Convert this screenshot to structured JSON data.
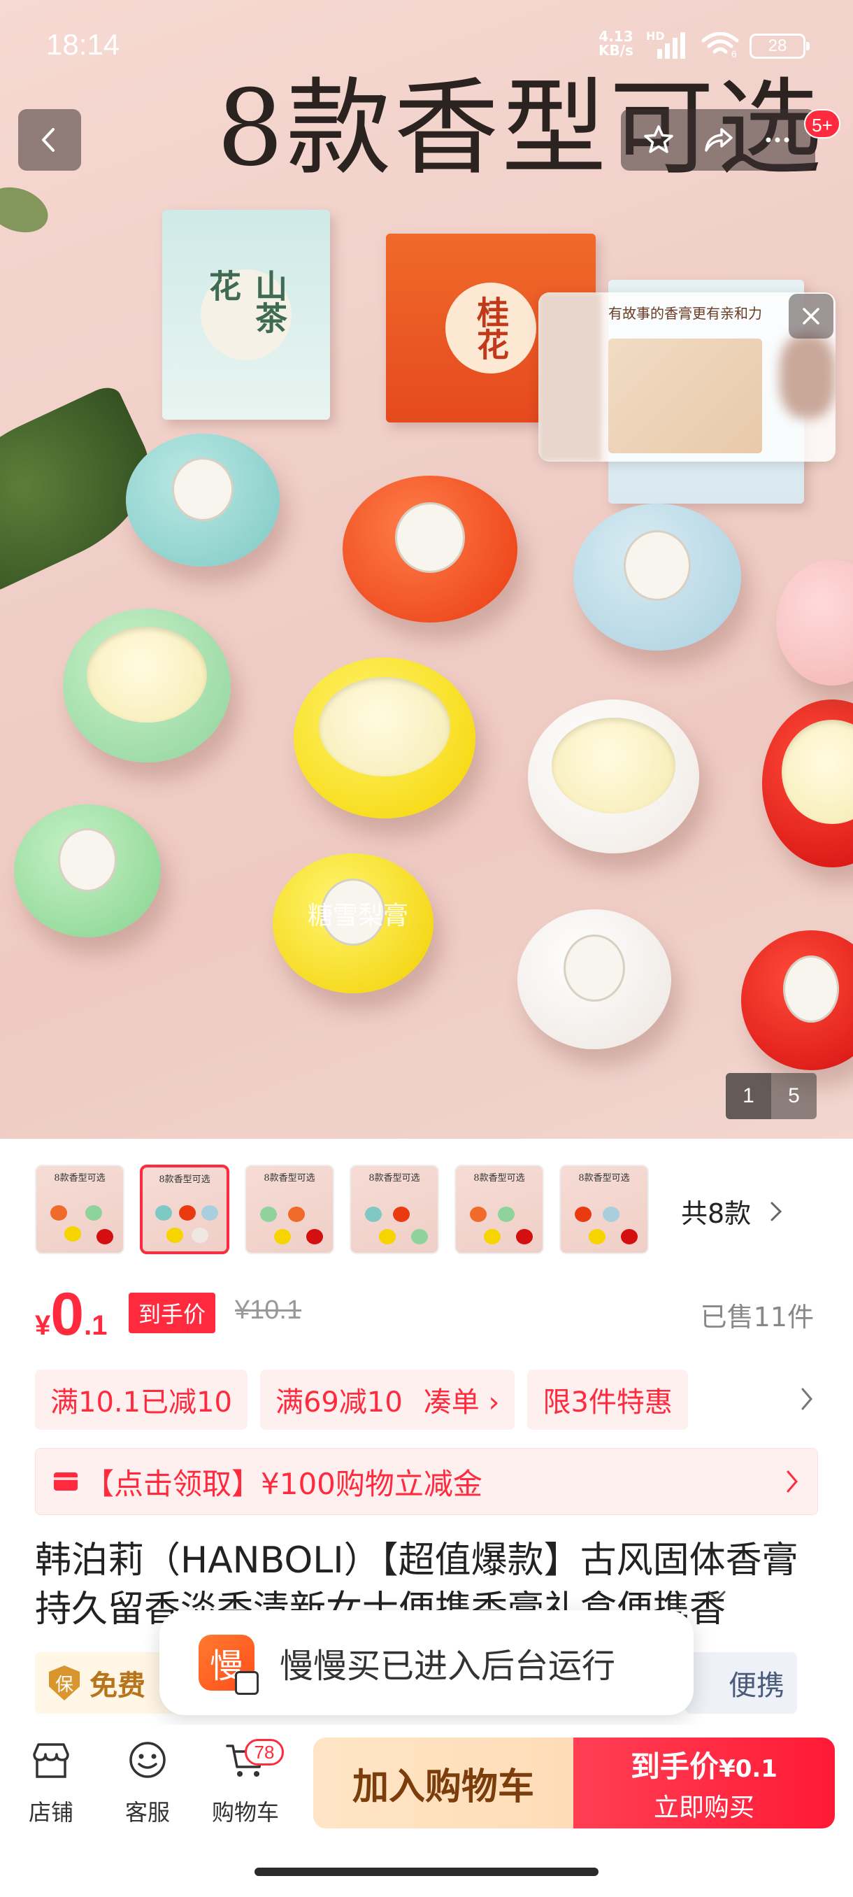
{
  "status_bar": {
    "time": "18:14",
    "net_speed": "4.13",
    "net_unit": "KB/s",
    "hd": "HD",
    "battery": "28",
    "wifi_badge": "6"
  },
  "hero": {
    "title": "8款香型可选",
    "watermark": "糖雪梨膏",
    "notification_count": "5+",
    "video_card_text": "有故事的香膏更有亲和力",
    "page_current": "1",
    "page_total": "5",
    "box_labels": [
      "山茶花",
      "桂花"
    ]
  },
  "thumbnails": {
    "count": 6,
    "active_index": 1,
    "thumb_title": "8款香型可选",
    "variants_label": "共8款"
  },
  "price": {
    "currency": "¥",
    "integer": "0",
    "decimal": ".1",
    "tag": "到手价",
    "original": "¥10.1",
    "sold": "已售11件"
  },
  "promos": [
    {
      "text": "满10.1已减10"
    },
    {
      "text": "满69减10",
      "extra": "凑单 ›"
    },
    {
      "text": "限3件特惠"
    }
  ],
  "coupon": {
    "text": "【点击领取】¥100购物立减金"
  },
  "product": {
    "title": "韩泊莉（HANBOLI）【超值爆款】古风固体香膏持久留香淡香清新女士便携香膏礼盒便携香"
  },
  "services": {
    "left": "免费",
    "left_icon": "保",
    "right": "便携"
  },
  "toast": {
    "logo_char": "慢",
    "text": "慢慢买已进入后台运行"
  },
  "bottom_nav": {
    "store": "店铺",
    "service": "客服",
    "cart": "购物车",
    "cart_count": "78",
    "add_to_cart": "加入购物车",
    "buy_price_label": "到手价",
    "buy_price": "¥0.1",
    "buy_now": "立即购买"
  },
  "colors": {
    "accent": "#ff2a3d",
    "promo_bg": "#fff0f0",
    "add_cart_bg": "#ffe5c6"
  }
}
